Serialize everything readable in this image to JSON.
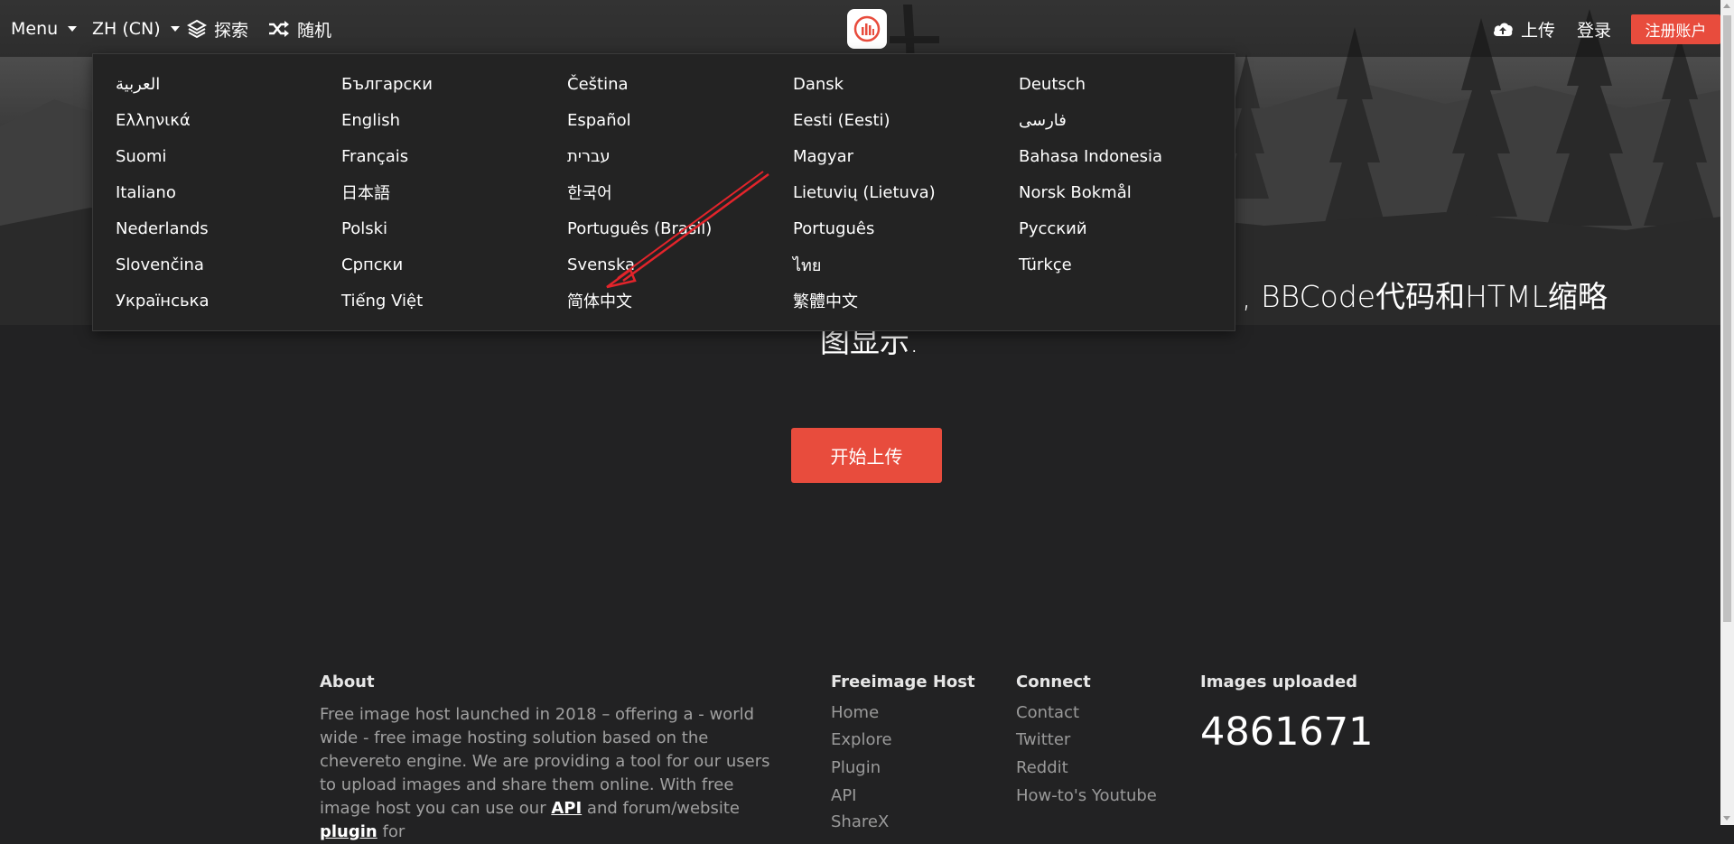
{
  "nav": {
    "menu_label": "Menu",
    "lang_label": "ZH (CN)",
    "explore_label": "探索",
    "random_label": "随机",
    "upload_label": "上传",
    "login_label": "登录",
    "signup_label": "注册账户"
  },
  "languages": [
    "العربية",
    "Български",
    "Čeština",
    "Dansk",
    "Deutsch",
    "Ελληνικά",
    "English",
    "Español",
    "Eesti (Eesti)",
    "فارسی",
    "Suomi",
    "Français",
    "עברית",
    "Magyar",
    "Bahasa Indonesia",
    "Italiano",
    "日本語",
    "한국어",
    "Lietuvių (Lietuva)",
    "Norsk Bokmål",
    "Nederlands",
    "Polski",
    "Português (Brasil)",
    "Português",
    "Русский",
    "Slovenčina",
    "Српски",
    "Svenska",
    "ไทย",
    "Türkçe",
    "Українська",
    "Tiếng Việt",
    "简体中文",
    "繁體中文"
  ],
  "hero": {
    "line1": ", BBCode代码和HTML缩略",
    "line2": "图显示.",
    "upload_button": "开始上传"
  },
  "footer": {
    "about_title": "About",
    "about_text": "Free image host launched in 2018 – offering a - world wide - free image hosting solution based on the chevereto engine. We are providing a tool for our users to upload images and share them online. With free image host you can use our",
    "about_api": "API",
    "about_and": "and forum/website",
    "about_plugin": "plugin",
    "about_for": "for",
    "host_title": "Freeimage Host",
    "host_links": [
      "Home",
      "Explore",
      "Plugin",
      "API",
      "ShareX"
    ],
    "connect_title": "Connect",
    "connect_links": [
      "Contact",
      "Twitter",
      "Reddit",
      "How-to's Youtube"
    ],
    "images_title": "Images uploaded",
    "images_count": "4861671"
  },
  "colors": {
    "accent": "#e84c3d",
    "background": "#222223",
    "annotation_arrow": "#e3242b"
  }
}
